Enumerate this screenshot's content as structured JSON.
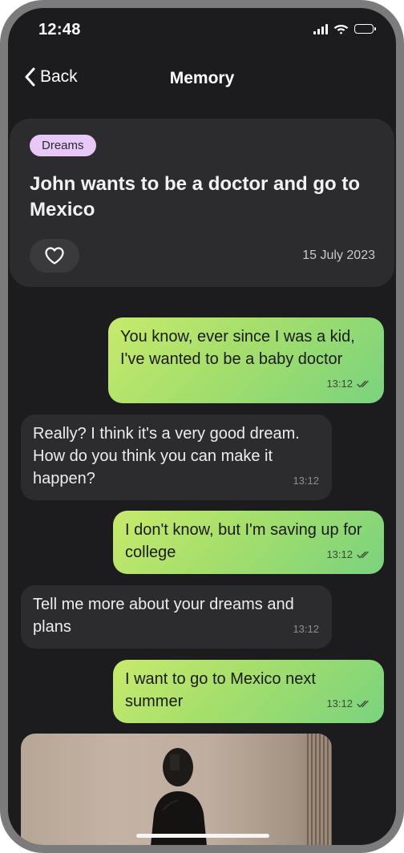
{
  "status_bar": {
    "time": "12:48",
    "icons": [
      "signal-icon",
      "wifi-icon",
      "battery-icon"
    ]
  },
  "nav": {
    "back_label": "Back",
    "title": "Memory"
  },
  "memory": {
    "tag": "Dreams",
    "title": "John wants to be a doctor and go to Mexico",
    "date": "15 July 2023",
    "like_icon": "heart-icon"
  },
  "messages": [
    {
      "direction": "sent",
      "text": "You know, ever since I was a kid, I've wanted to be a baby doctor",
      "time": "13:12",
      "read": true
    },
    {
      "direction": "received",
      "text": "Really? I think it's a very good dream. How do you think you can make it happen?",
      "time": "13:12"
    },
    {
      "direction": "sent",
      "text": "I don't know, but I'm saving up for college",
      "time": "13:12",
      "read": true
    },
    {
      "direction": "received",
      "text": "Tell me more about your dreams and plans",
      "time": "13:12"
    },
    {
      "direction": "sent",
      "text": "I want to go to Mexico next summer",
      "time": "13:12",
      "read": true
    }
  ],
  "colors": {
    "background": "#1c1c1e",
    "card": "#2c2c2e",
    "tag": "#e7c8f7",
    "sent_gradient_start": "#c7ea6c",
    "sent_gradient_end": "#7ad37e"
  }
}
